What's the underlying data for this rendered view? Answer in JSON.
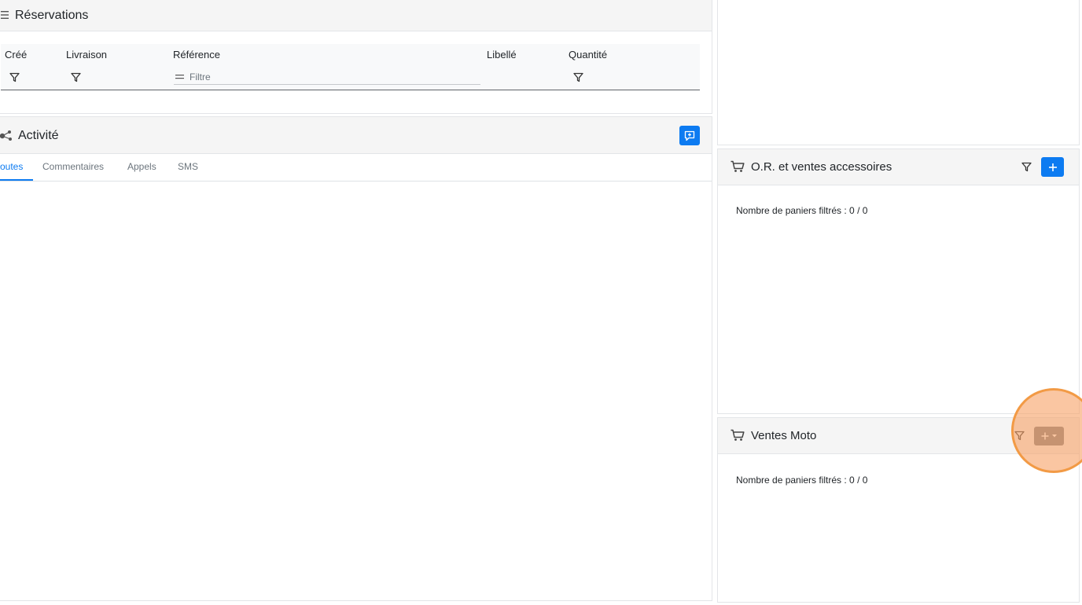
{
  "reservations": {
    "title": "Réservations",
    "columns": [
      "Créé",
      "Livraison",
      "Référence",
      "Libellé",
      "Quantité"
    ],
    "reference_filter_placeholder": "Filtre"
  },
  "activity": {
    "title": "Activité",
    "tabs": [
      "outes",
      "Commentaires",
      "Appels",
      "SMS"
    ],
    "active_tab": 0
  },
  "paniers": {
    "title": "O.R. et ventes accessoires",
    "count_text": "Nombre de paniers filtrés : 0 / 0"
  },
  "motos": {
    "title": "Ventes Moto",
    "count_text": "Nombre de paniers filtrés : 0 / 0"
  },
  "colors": {
    "accent": "#0d7bf1",
    "gray_button": "#7d8186",
    "highlight": "#f29a45"
  },
  "icons": [
    "list-icon",
    "activity-icon",
    "filter-icon",
    "equals-icon",
    "add-comment-icon",
    "cart-icon",
    "plus-icon",
    "caret-down-icon"
  ]
}
